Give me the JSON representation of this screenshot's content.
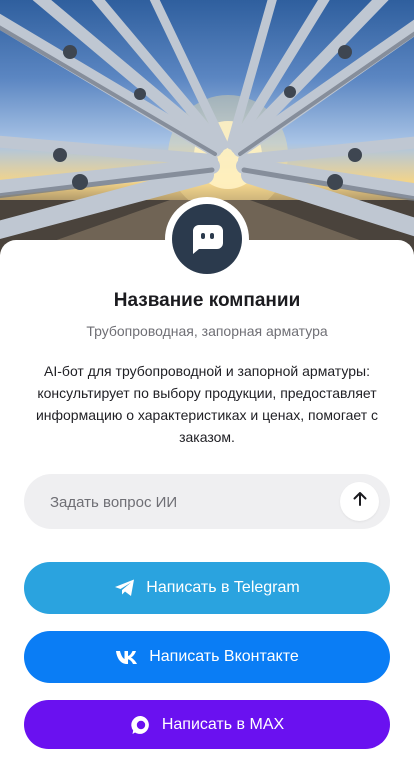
{
  "company": {
    "name": "Название компании",
    "category": "Трубопроводная, запорная арматура",
    "description": "AI-бот для трубопроводной и запорной арматуры: консультирует по выбору продукции, предоставляет информацию о характеристиках и ценах, помогает с заказом."
  },
  "ask": {
    "placeholder": "Задать вопрос ИИ",
    "send_icon": "arrow-up-icon"
  },
  "buttons": {
    "telegram": {
      "label": "Написать в Telegram",
      "icon": "telegram-icon",
      "color": "#2aa3df"
    },
    "vk": {
      "label": "Написать Вконтакте",
      "icon": "vk-icon",
      "color": "#0a7df5"
    },
    "max": {
      "label": "Написать в MAX",
      "icon": "max-icon",
      "color": "#6a11f0"
    }
  },
  "colors": {
    "avatar_bg": "#2b3a4d",
    "ask_bg": "#efeff1"
  }
}
